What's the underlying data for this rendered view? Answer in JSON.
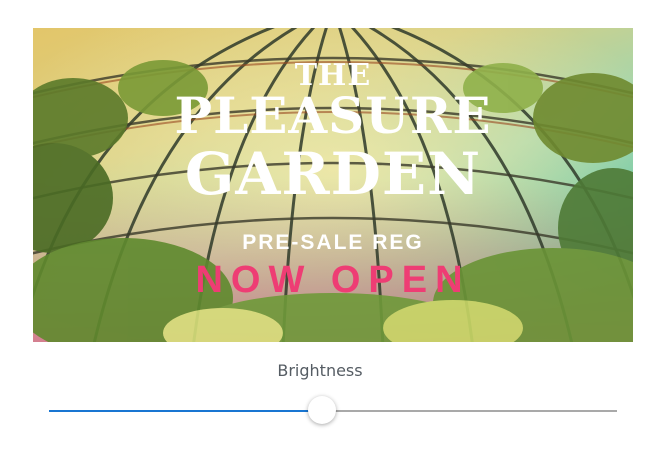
{
  "banner": {
    "title_line1": "THE",
    "title_line2": "PLEASURE",
    "title_line3": "GARDEN",
    "subtitle": "PRE-SALE REG",
    "headline": "NOW OPEN",
    "colors": {
      "headline": "#ee3d74",
      "title": "#ffffff"
    }
  },
  "brightness_slider": {
    "label": "Brightness",
    "value_fraction": 0.48,
    "colors": {
      "fill": "#1976d2",
      "track": "#a9a9a9"
    }
  }
}
